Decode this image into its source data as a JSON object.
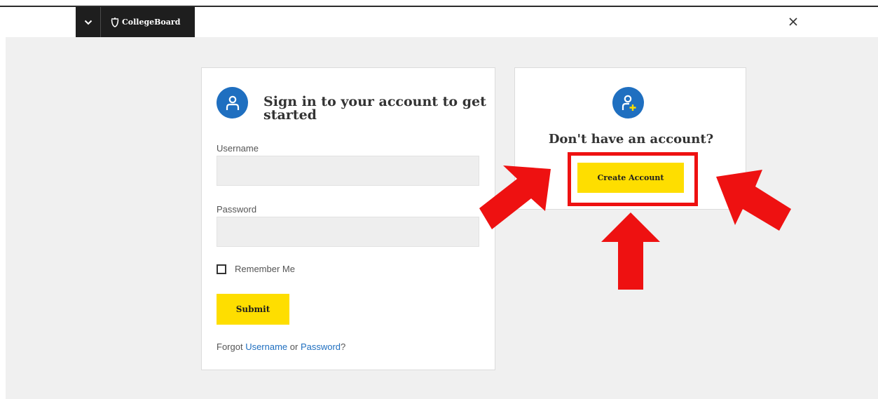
{
  "header": {
    "brand": "CollegeBoard",
    "menu_icon": "chevron-down-icon",
    "logo_icon": "acorn-icon",
    "close_icon": "close-icon"
  },
  "signin": {
    "title": "Sign in to your account to get started",
    "avatar_icon": "user-icon",
    "username_label": "Username",
    "username_value": "",
    "password_label": "Password",
    "password_value": "",
    "remember_label": "Remember Me",
    "remember_checked": false,
    "submit_label": "Submit",
    "forgot_prefix": "Forgot ",
    "forgot_username": "Username",
    "forgot_or": " or ",
    "forgot_password": "Password",
    "forgot_suffix": "?"
  },
  "signup": {
    "avatar_icon": "add-user-icon",
    "title": "Don't have an account?",
    "create_label": "Create Account"
  },
  "annotation": {
    "highlight_color": "#ee1111",
    "arrow_color": "#ee1111"
  },
  "colors": {
    "accent_yellow": "#fede00",
    "brand_blue": "#1f6fc0",
    "header_dark": "#1e1e1e",
    "background": "#f0f0f0"
  }
}
